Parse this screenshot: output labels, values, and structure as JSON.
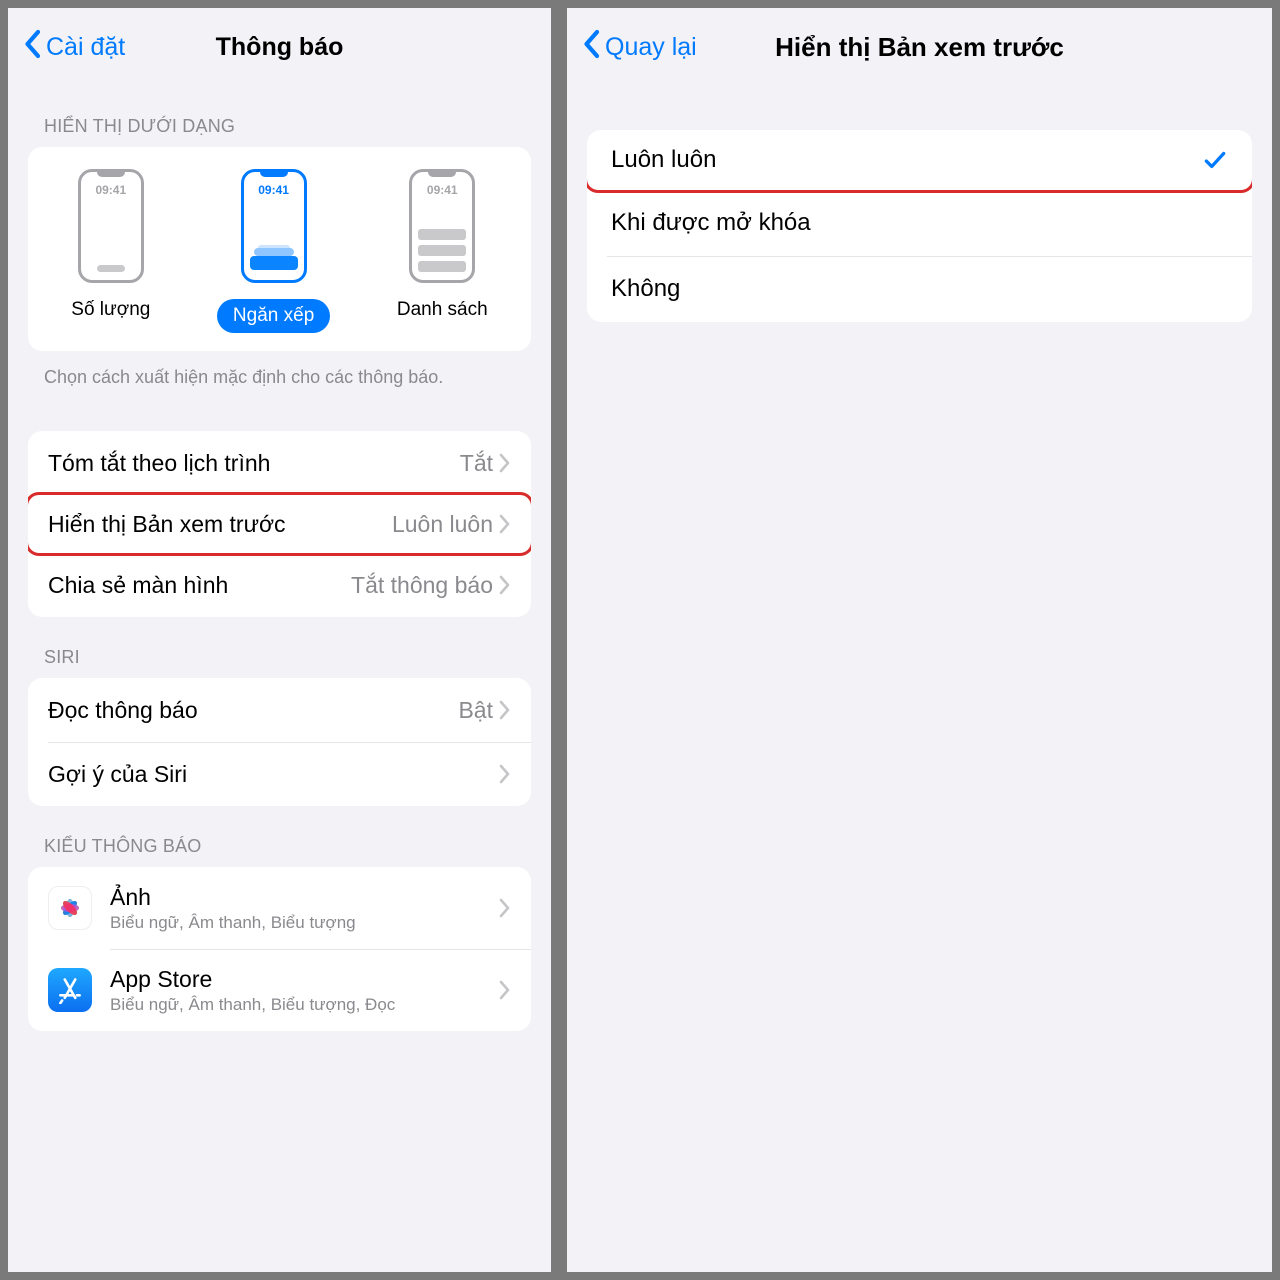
{
  "left": {
    "back_label": "Cài đặt",
    "title": "Thông báo",
    "section_display_as": "HIỂN THỊ DƯỚI DẠNG",
    "display_options": {
      "count": "Số lượng",
      "stack": "Ngăn xếp",
      "list": "Danh sách",
      "time": "09:41"
    },
    "display_caption": "Chọn cách xuất hiện mặc định cho các thông báo.",
    "rows1": {
      "scheduled_summary": {
        "label": "Tóm tắt theo lịch trình",
        "value": "Tắt"
      },
      "show_previews": {
        "label": "Hiển thị Bản xem trước",
        "value": "Luôn luôn"
      },
      "screen_sharing": {
        "label": "Chia sẻ màn hình",
        "value": "Tắt thông báo"
      }
    },
    "section_siri": "SIRI",
    "rows2": {
      "announce": {
        "label": "Đọc thông báo",
        "value": "Bật"
      },
      "suggestions": {
        "label": "Gợi ý của Siri"
      }
    },
    "section_style": "KIỂU THÔNG BÁO",
    "apps": {
      "photos": {
        "name": "Ảnh",
        "sub": "Biểu ngữ, Âm thanh, Biểu tượng"
      },
      "appstore": {
        "name": "App Store",
        "sub": "Biểu ngữ, Âm thanh, Biểu tượng, Đọc"
      }
    }
  },
  "right": {
    "back_label": "Quay lại",
    "title": "Hiển thị Bản xem trước",
    "options": {
      "always": "Luôn luôn",
      "unlocked": "Khi được mở khóa",
      "never": "Không"
    }
  }
}
